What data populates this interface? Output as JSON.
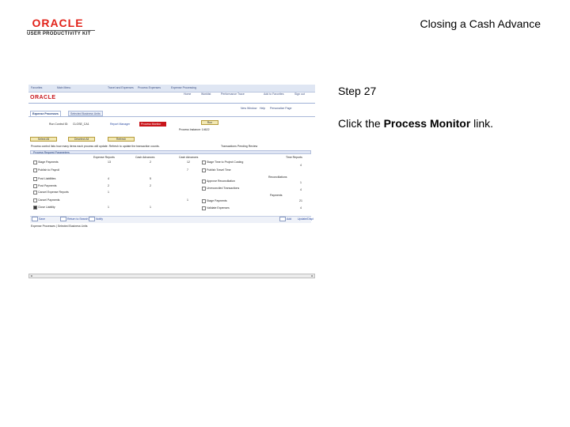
{
  "header": {
    "logo_brand": "ORACLE",
    "logo_subtitle": "USER PRODUCTIVITY KIT",
    "document_title": "Closing a Cash Advance"
  },
  "step": {
    "label": "Step 27",
    "instruction_prefix": "Click the ",
    "instruction_target": "Process Monitor",
    "instruction_suffix": " link."
  },
  "screenshot": {
    "top_nav": [
      "Favorites",
      "Main Menu",
      "Travel and Expenses",
      "Process Expenses",
      "Expense Processing"
    ],
    "header_links": [
      "Home",
      "Worklist",
      "Performance Trace",
      "Add to Favorites",
      "Sign out"
    ],
    "window_links": [
      "New Window",
      "Help",
      "Personalize Page"
    ],
    "tabs": [
      "Expense Processes",
      "Selected Business Units"
    ],
    "run_control_label": "Run Control ID:",
    "run_control_value": "CLOSE_CA1",
    "report_manager": "Report Manager",
    "process_monitor": "Process Monitor",
    "run_button": "Run",
    "process_instance": "Process Instance: 14622",
    "select_all": "Select All",
    "deselect_all": "Deselect All",
    "refresh": "Refresh",
    "last_update": "Transactions Pending Review",
    "section_title": "Process Request Parameters",
    "intro_text": "Process control lists how many items each process will update. Refresh to update the transaction counts.",
    "col_headers": [
      "Expense Reports",
      "Cash Advances",
      "Cash Advances",
      "Time Reports"
    ],
    "left_rows": [
      {
        "label": "Stage Payments",
        "v1": "13",
        "v2": "2",
        "v3": "12"
      },
      {
        "label": "Publish to Payroll",
        "v1": "",
        "v2": "",
        "v3": "7"
      },
      {
        "label": "Post Liabilities",
        "v1": "4",
        "v2": "5",
        "v3": ""
      },
      {
        "label": "Post Payments",
        "v1": "2",
        "v2": "2",
        "v3": ""
      },
      {
        "label": "Cancel Expense Reports",
        "v1": "1",
        "v2": "",
        "v3": ""
      },
      {
        "label": "Cancel Payments",
        "v1": "",
        "v2": "",
        "v3": "1"
      },
      {
        "label": "Close Liability",
        "v1": "1",
        "v2": "1",
        "v3": ""
      }
    ],
    "right_rows": [
      {
        "label": "Stage Time to Project Costing",
        "v": "4"
      },
      {
        "label": "Publish Travel Time",
        "v": ""
      },
      {
        "label": "Approve Reconciliation",
        "v": "1"
      },
      {
        "label": "Unreconciled Transactions",
        "v": "4"
      },
      {
        "label": "Stage Payments",
        "v": "21"
      },
      {
        "label": "Validate Expenses",
        "v": "4"
      }
    ],
    "right_sublabels": [
      "Reconciliations",
      "Payments"
    ],
    "breadcrumb_bottom": "Expense Processes | Selected Business Units",
    "bottom_buttons": [
      "Save",
      "Return to Search",
      "Notify"
    ],
    "bottom_right": [
      "Add",
      "Update/Display"
    ]
  },
  "colors": {
    "oracle_red": "#e2231a",
    "nav_blue": "#3a4d80",
    "button_yellow": "#f2e8b3"
  }
}
